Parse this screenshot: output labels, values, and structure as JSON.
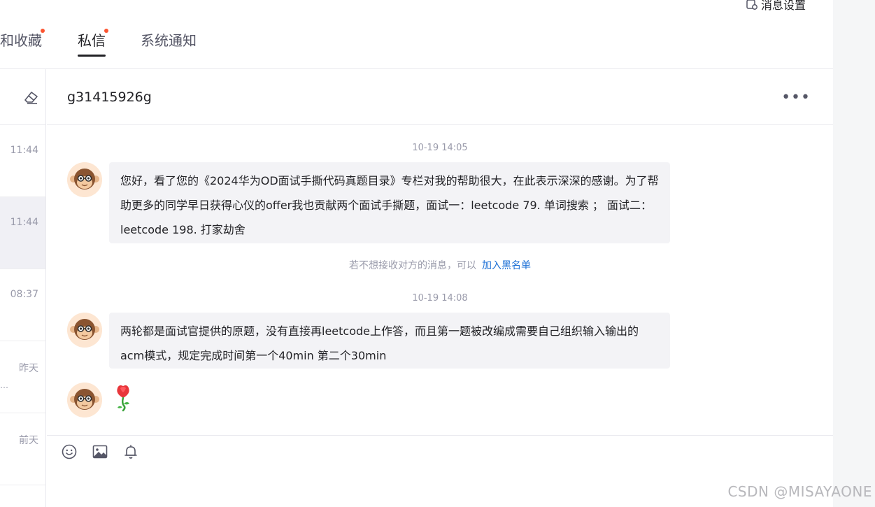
{
  "header": {
    "settings_label": "消息设置",
    "tabs": [
      {
        "label": "和收藏",
        "has_dot": true,
        "active": false
      },
      {
        "label": "私信",
        "has_dot": true,
        "active": true
      },
      {
        "label": "系统通知",
        "has_dot": false,
        "active": false
      }
    ]
  },
  "conversations": [
    {
      "time": "11:44",
      "active": false
    },
    {
      "time": "11:44",
      "active": true
    },
    {
      "time": "08:37",
      "active": false
    },
    {
      "time": "昨天",
      "preview": "…",
      "active": false
    },
    {
      "time": "前天",
      "active": false
    }
  ],
  "chat": {
    "title": "g31415926g",
    "more_label": "•••",
    "stamp1": "10-19 14:05",
    "msg1": "您好，看了您的《2024华为OD面试手撕代码真题目录》专栏对我的帮助很大，在此表示深深的感谢。为了帮助更多的同学早日获得心仪的offer我也贡献两个面试手撕题，面试一：leetcode 79. 单词搜索 ； 面试二：leetcode 198. 打家劫舍",
    "notice_text": "若不想接收对方的消息，可以",
    "notice_link": "加入黑名单",
    "stamp2": "10-19 14:08",
    "msg2": "两轮都是面试官提供的原题，没有直接再leetcode上作答，而且第一题被改编成需要自己组织输入输出的acm模式，规定完成时间第一个40min 第二个30min",
    "msg3_icon": "rose-emoji"
  },
  "toolbar": {
    "icons": [
      "emoji-icon",
      "image-icon",
      "bell-icon"
    ]
  },
  "watermark": "CSDN @MISAYAONE",
  "colors": {
    "accent_dot": "#fc5531",
    "link": "#1b6fd6",
    "bubble": "#f3f3f6"
  }
}
